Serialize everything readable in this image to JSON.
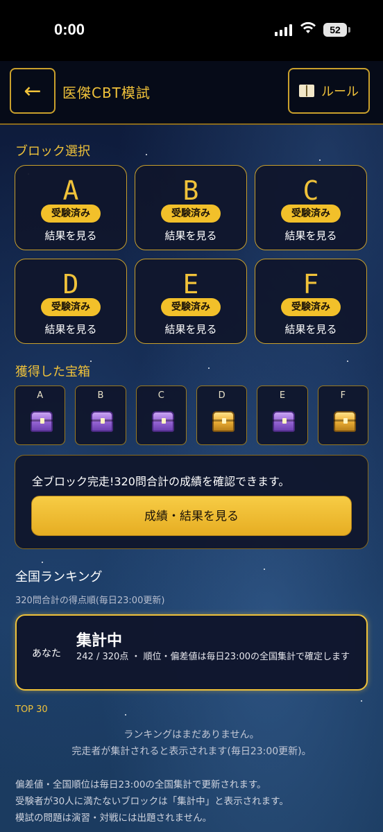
{
  "status_bar": {
    "time": "0:00",
    "battery": "52"
  },
  "header": {
    "back_icon": "←",
    "title": "医傑CBT模試",
    "rule_icon": "book-icon",
    "rule_label": "ルール"
  },
  "block_section": {
    "label": "ブロック選択",
    "blocks": [
      {
        "letter": "A",
        "badge": "受験済み",
        "link": "結果を見る"
      },
      {
        "letter": "B",
        "badge": "受験済み",
        "link": "結果を見る"
      },
      {
        "letter": "C",
        "badge": "受験済み",
        "link": "結果を見る"
      },
      {
        "letter": "D",
        "badge": "受験済み",
        "link": "結果を見る"
      },
      {
        "letter": "E",
        "badge": "受験済み",
        "link": "結果を見る"
      },
      {
        "letter": "F",
        "badge": "受験済み",
        "link": "結果を見る"
      }
    ]
  },
  "treasure_section": {
    "label": "獲得した宝箱",
    "chests": [
      {
        "label": "A",
        "type": "purple"
      },
      {
        "label": "B",
        "type": "purple"
      },
      {
        "label": "C",
        "type": "purple"
      },
      {
        "label": "D",
        "type": "gold"
      },
      {
        "label": "E",
        "type": "purple"
      },
      {
        "label": "F",
        "type": "gold"
      }
    ]
  },
  "complete_panel": {
    "text": "全ブロック完走!320問合計の成績を確認できます。",
    "button_label": "成績・結果を見る"
  },
  "ranking": {
    "title": "全国ランキング",
    "subtitle": "320問合計の得点順(毎日23:00更新)",
    "you_label": "あなた",
    "you_status": "集計中",
    "you_detail": "242 / 320点 ・ 順位・偏差値は毎日23:00の全国集計で確定します",
    "top_label": "TOP 30",
    "empty_line1": "ランキングはまだありません。",
    "empty_line2": "完走者が集計されると表示されます(毎日23:00更新)。"
  },
  "notes": [
    "偏差値・全国順位は毎日23:00の全国集計で更新されます。",
    "受験者が30人に満たないブロックは「集計中」と表示されます。",
    "模試の問題は演習・対戦には出題されません。"
  ],
  "colors": {
    "gold": "#f0c23a",
    "panel": "#10162c",
    "bg_top": "#0d1735",
    "bg_bottom": "#1b3b60",
    "chest_purple": "#9b6ad8",
    "chest_gold": "#f0b33a"
  }
}
